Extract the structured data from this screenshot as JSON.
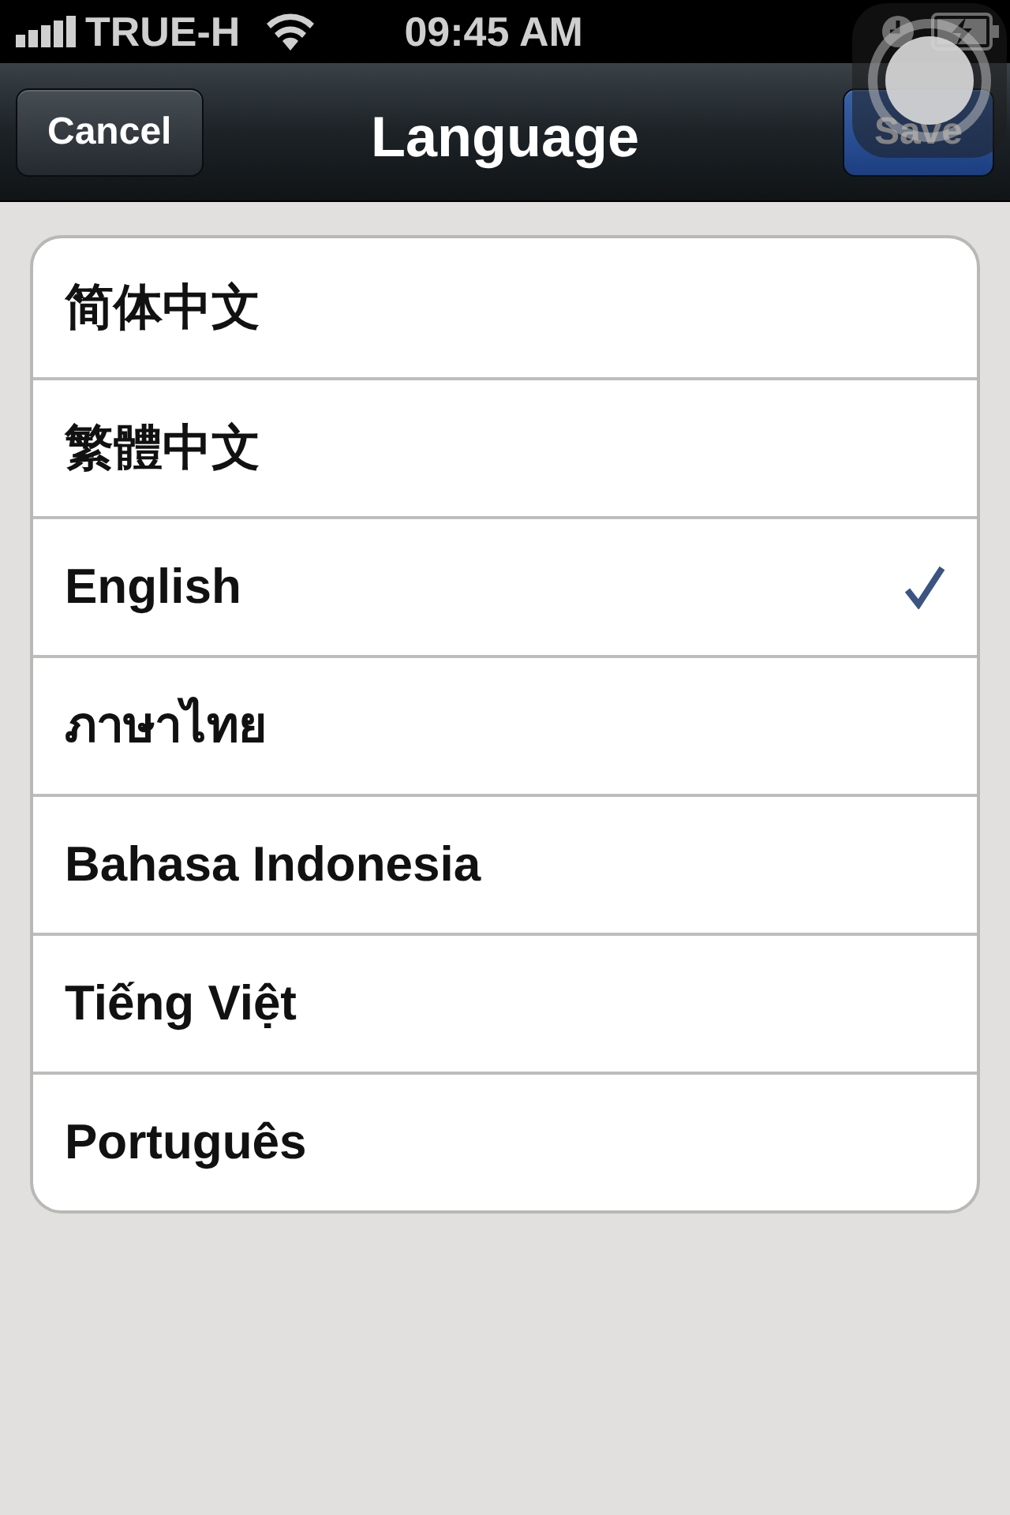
{
  "status_bar": {
    "carrier": "TRUE-H",
    "time": "09:45 AM"
  },
  "nav_bar": {
    "title": "Language",
    "left_button": "Cancel",
    "right_button": "Save"
  },
  "languages": [
    {
      "label": "简体中文",
      "selected": false
    },
    {
      "label": "繁體中文",
      "selected": false
    },
    {
      "label": "English",
      "selected": true
    },
    {
      "label": "ภาษาไทย",
      "selected": false
    },
    {
      "label": "Bahasa Indonesia",
      "selected": false
    },
    {
      "label": "Tiếng Việt",
      "selected": false
    },
    {
      "label": "Português",
      "selected": false
    }
  ]
}
